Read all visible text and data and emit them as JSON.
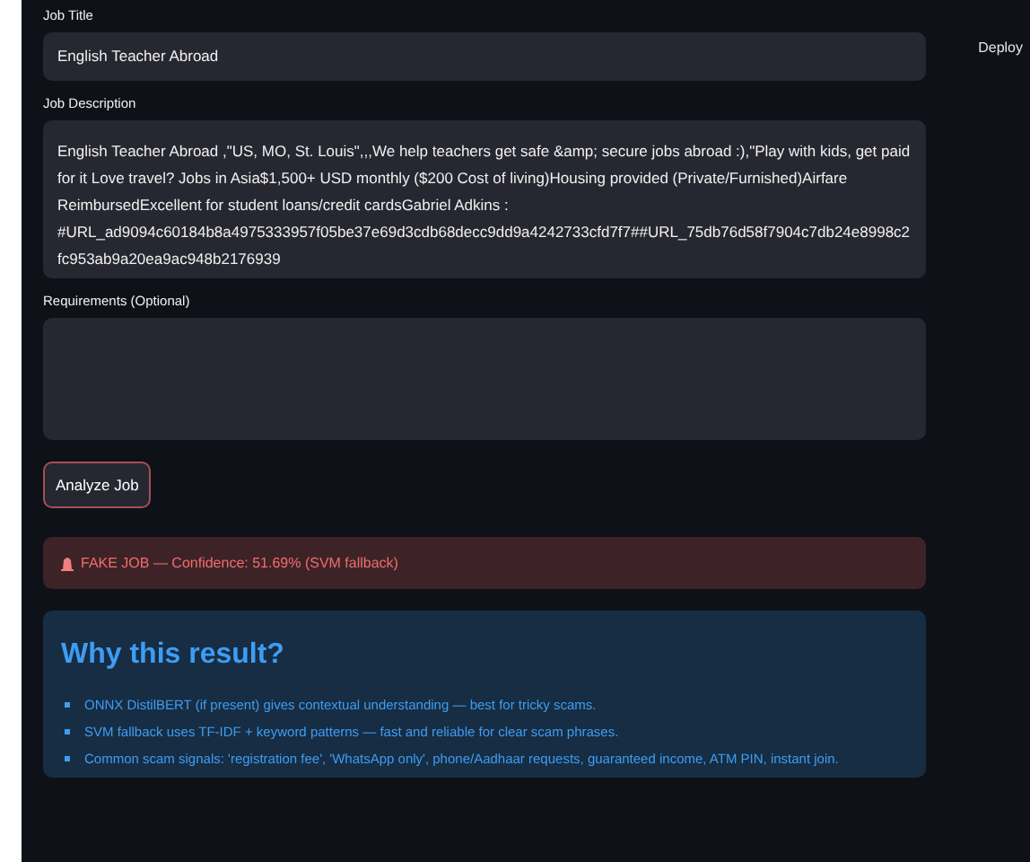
{
  "header": {
    "deploy": "Deploy"
  },
  "fields": [
    {
      "kind": "input",
      "label": "Job Title",
      "value": "English Teacher Abroad"
    },
    {
      "kind": "textarea",
      "label": "Job Description",
      "value": "English Teacher Abroad ,\"US, MO, St. Louis\",,,We help teachers get safe &amp; secure jobs abroad :),\"Play with kids, get paid for it Love travel? Jobs in Asia$1,500+ USD monthly ($200 Cost of living)Housing provided (Private/Furnished)Airfare ReimbursedExcellent for student loans/credit cardsGabriel Adkins : #URL_ad9094c60184b8a4975333957f05be37e69d3cdb68decc9dd9a4242733cfd7f7##URL_75db76d58f7904c7db24e8998c2fc953ab9a20ea9ac948b2176939"
    },
    {
      "kind": "textarea",
      "label": "Requirements (Optional)"
    }
  ],
  "analyze_button": "Analyze Job",
  "result": {
    "kind": "error",
    "text": "FAKE JOB — Confidence: 51.69% (SVM fallback)"
  },
  "explanation": {
    "title": "Why this result?",
    "items": [
      "ONNX DistilBERT (if present) gives contextual understanding — best for tricky scams.",
      "SVM fallback uses TF-IDF + keyword patterns — fast and reliable for clear scam phrases.",
      "Common scam signals: 'registration fee', 'WhatsApp only', phone/Aadhaar requests, guaranteed income, ATM PIN, instant join."
    ]
  }
}
